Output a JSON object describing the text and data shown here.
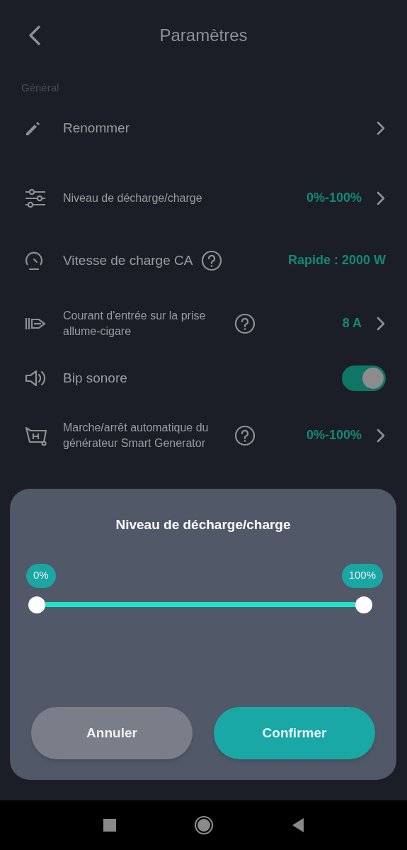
{
  "header": {
    "title": "Paramètres"
  },
  "section": {
    "title": "Général"
  },
  "rows": [
    {
      "kind": "link",
      "label": "Renommer"
    },
    {
      "kind": "value",
      "label": "Niveau de décharge/charge",
      "value": "0%-100%",
      "help": false,
      "chevron": true
    },
    {
      "kind": "value",
      "label": "Vitesse de charge CA",
      "value": "Rapide : 2000 W",
      "help": true,
      "chevron": false
    },
    {
      "kind": "value",
      "label": "Courant d'entrée sur la prise allume-cigare",
      "value": "8 A",
      "help": true,
      "chevron": true
    },
    {
      "kind": "toggle",
      "label": "Bip sonore",
      "on": true
    },
    {
      "kind": "value",
      "label": "Marche/arrêt automatique du générateur Smart Generator",
      "value": "0%-100%",
      "help": true,
      "chevron": true
    }
  ],
  "dialog": {
    "title": "Niveau de décharge/charge",
    "thumbs": [
      {
        "label": "0%"
      },
      {
        "label": "100%"
      }
    ],
    "buttons": [
      {
        "kind": "cancel",
        "label": "Annuler"
      },
      {
        "kind": "confirm",
        "label": "Confirmer"
      }
    ]
  }
}
